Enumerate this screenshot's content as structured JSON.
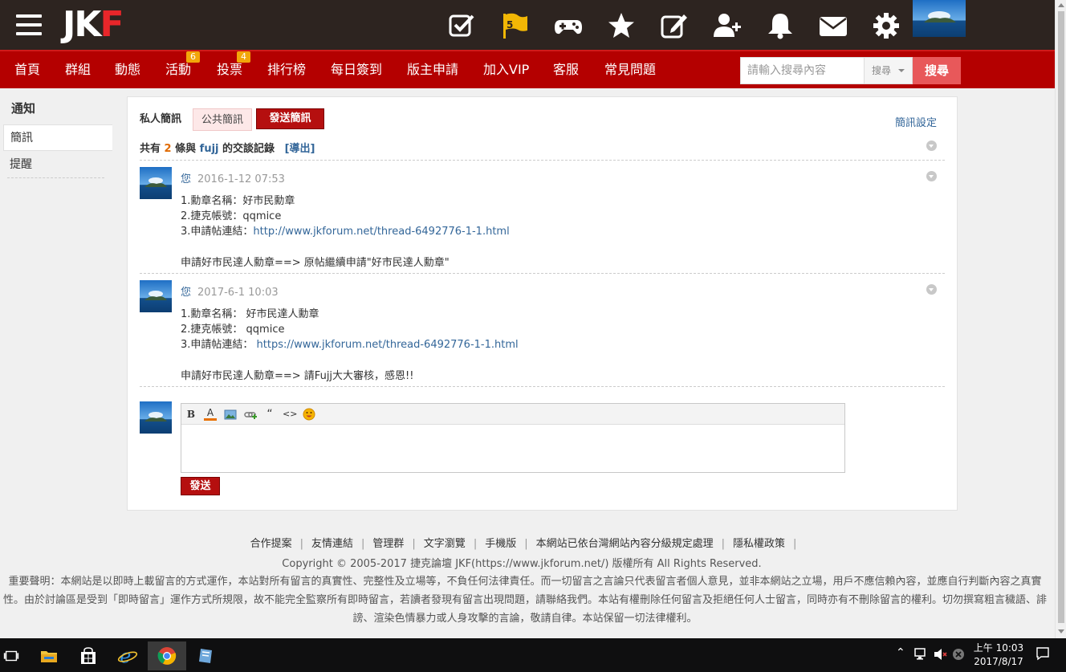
{
  "header": {
    "logo_jk": "JK",
    "logo_f": "F",
    "flag_badge": "5",
    "icons": [
      "checkbox-icon",
      "flag-icon",
      "gamepad-icon",
      "star-icon",
      "edit-icon",
      "add-user-icon",
      "bell-icon",
      "mail-icon",
      "gear-icon"
    ]
  },
  "nav": {
    "items": [
      "首頁",
      "群組",
      "動態",
      "活動",
      "投票",
      "排行榜",
      "每日簽到",
      "版主申請",
      "加入VIP",
      "客服",
      "常見問題"
    ],
    "badges": {
      "activity": "6",
      "vote": "4"
    },
    "search_placeholder": "請輸入搜尋內容",
    "search_select": "搜尋",
    "search_button": "搜尋"
  },
  "sidebar": {
    "title": "通知",
    "items": [
      "簡訊",
      "提醒"
    ]
  },
  "panel": {
    "tab_private": "私人簡訊",
    "tab_public": "公共簡訊",
    "send_button": "發送簡訊",
    "settings_link": "簡訊設定",
    "summary": {
      "prefix": "共有",
      "count": "2",
      "middle": "條與",
      "user": "fujj",
      "suffix": "的交談記錄",
      "export": "[導出]"
    },
    "messages": [
      {
        "who": "您",
        "time": "2016-1-12 07:53",
        "line1": "1.勳章名稱：好市民勳章",
        "line2": "2.捷克帳號：qqmice",
        "line3_label": "3.申請帖連結：",
        "line3_link": "http://www.jkforum.net/thread-6492776-1-1.html",
        "line4": "申請好市民達人勳章==> 原帖繼續申請\"好市民達人勳章\""
      },
      {
        "who": "您",
        "time": "2017-6-1 10:03",
        "line1": "1.勳章名稱： 好市民達人勳章",
        "line2": "2.捷克帳號： qqmice",
        "line3_label": "3.申請帖連結： ",
        "line3_link": "https://www.jkforum.net/thread-6492776-1-1.html",
        "line4": "申請好市民達人勳章==> 請Fujj大大審核，感恩!!"
      }
    ],
    "editor_toolbar": [
      "B",
      "A",
      "image-icon",
      "link-icon",
      "“",
      "<>",
      "emoji-icon"
    ],
    "submit_button": "發送"
  },
  "footer": {
    "links": [
      "合作提案",
      "友情連結",
      "管理群",
      "文字瀏覽",
      "手機版",
      "本網站已依台灣網站內容分級規定處理",
      "隱私權政策"
    ],
    "copyright": "Copyright © 2005-2017 捷克論壇 JKF(https://www.jkforum.net/) 版權所有 All Rights Reserved.",
    "disclaimer": "重要聲明：本網站是以即時上載留言的方式運作，本站對所有留言的真實性、完整性及立場等，不負任何法律責任。而一切留言之言論只代表留言者個人意見，並非本網站之立場，用戶不應信賴內容，並應自行判斷內容之真實性。由於討論區是受到「即時留言」運作方式所規限，故不能完全監察所有即時留言，若讀者發現有留言出現問題，請聯絡我們。本站有權刪除任何留言及拒絕任何人士留言，同時亦有不刪除留言的權利。切勿撰寫粗言穢語、誹謗、渲染色情暴力或人身攻擊的言論，敬請自律。本站保留一切法律權利。"
  },
  "taskbar": {
    "clock_time": "上午 10:03",
    "clock_date": "2017/8/17"
  },
  "colors": {
    "topbar": "#2d2420",
    "navbar": "#b40000",
    "accent_red": "#b50f0f",
    "link_blue": "#336699"
  }
}
